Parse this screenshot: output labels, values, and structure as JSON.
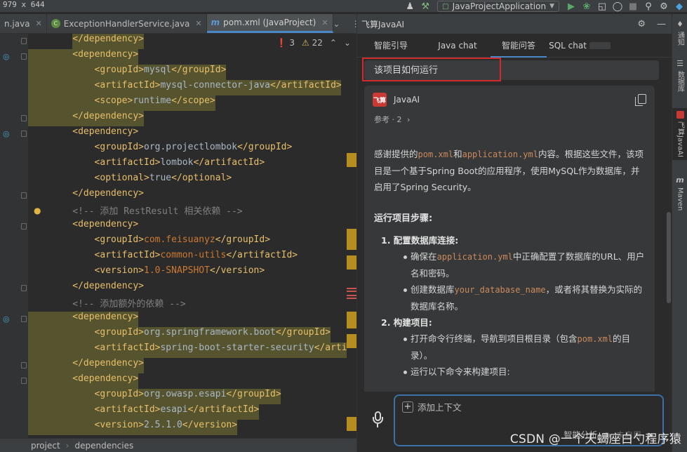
{
  "screen_dims_label": "979 x 644",
  "toolbar": {
    "run_config": "JavaProjectApplication",
    "icons": [
      "user-icon",
      "hammer-icon",
      "run-config-icon",
      "run-icon",
      "debug-icon",
      "coverage-icon",
      "profile-icon",
      "stop-icon",
      "search-icon",
      "settings-icon",
      "jetbrains-logo-icon"
    ]
  },
  "editor_tabs": [
    {
      "label": "n.java",
      "icon": "java-file-icon",
      "active": false
    },
    {
      "label": "ExceptionHandlerService.java",
      "icon": "java-class-icon",
      "active": false
    },
    {
      "label": "pom.xml (JavaProject)",
      "icon": "maven-icon",
      "active": true
    }
  ],
  "inspection": {
    "errors": "3",
    "warnings": "22"
  },
  "code_lines": [
    {
      "indent": 4,
      "parts": [
        [
          "tag",
          "</dependency>"
        ]
      ],
      "hl": [
        [
          "tag",
          0,
          0
        ]
      ],
      "hl_line": false
    },
    {
      "indent": 4,
      "parts": [
        [
          "tag",
          "<dependency>"
        ]
      ],
      "hl_line": true
    },
    {
      "indent": 8,
      "parts": [
        [
          "tag",
          "<groupId>"
        ],
        [
          "val",
          "mysql"
        ],
        [
          "tag",
          "</groupId>"
        ]
      ],
      "hl_line": true
    },
    {
      "indent": 8,
      "parts": [
        [
          "tag",
          "<artifactId>"
        ],
        [
          "val",
          "mysql-connector-java"
        ],
        [
          "tag",
          "</artifactId>"
        ]
      ],
      "hl_line": true
    },
    {
      "indent": 8,
      "parts": [
        [
          "tag",
          "<scope>"
        ],
        [
          "val",
          "runtime"
        ],
        [
          "tag",
          "</scope>"
        ]
      ],
      "hl_line": true
    },
    {
      "indent": 4,
      "parts": [
        [
          "tag",
          "</dependency>"
        ]
      ],
      "hl_line": true
    },
    {
      "indent": 4,
      "parts": [
        [
          "tag",
          "<dependency>"
        ]
      ],
      "hl_line": false
    },
    {
      "indent": 8,
      "parts": [
        [
          "tag",
          "<groupId>"
        ],
        [
          "val",
          "org.projectlombok"
        ],
        [
          "tag",
          "</groupId>"
        ]
      ],
      "hl_line": false
    },
    {
      "indent": 8,
      "parts": [
        [
          "tag",
          "<artifactId>"
        ],
        [
          "val",
          "lombok"
        ],
        [
          "tag",
          "</artifactId>"
        ]
      ],
      "hl_line": false
    },
    {
      "indent": 8,
      "parts": [
        [
          "tag",
          "<optional>"
        ],
        [
          "val",
          "true"
        ],
        [
          "tag",
          "</optional>"
        ]
      ],
      "hl_line": false
    },
    {
      "indent": 4,
      "parts": [
        [
          "tag",
          "</dependency>"
        ]
      ],
      "hl_line": false
    },
    {
      "indent": 4,
      "parts": [
        [
          "cmt",
          "<!-- 添加 RestResult 相关依赖 -->"
        ]
      ],
      "hl_line": false
    },
    {
      "indent": 4,
      "parts": [
        [
          "tag",
          "<dependency>"
        ]
      ],
      "hl_line": false
    },
    {
      "indent": 8,
      "parts": [
        [
          "tag",
          "<groupId>"
        ],
        [
          "dep",
          "com.feisuanyz"
        ],
        [
          "tag",
          "</groupId>"
        ]
      ],
      "hl_line": false
    },
    {
      "indent": 8,
      "parts": [
        [
          "tag",
          "<artifactId>"
        ],
        [
          "dep",
          "common-utils"
        ],
        [
          "tag",
          "</artifactId>"
        ]
      ],
      "hl_line": false
    },
    {
      "indent": 8,
      "parts": [
        [
          "tag",
          "<version>"
        ],
        [
          "dep",
          "1.0-SNAPSHOT"
        ],
        [
          "tag",
          "</version>"
        ]
      ],
      "hl_line": false
    },
    {
      "indent": 4,
      "parts": [
        [
          "tag",
          "</dependency>"
        ]
      ],
      "hl_line": false
    },
    {
      "indent": 4,
      "parts": [
        [
          "cmt",
          "<!-- 添加额外的依赖 -->"
        ]
      ],
      "hl_line": false
    },
    {
      "indent": 4,
      "parts": [
        [
          "tag",
          "<dependency>"
        ]
      ],
      "hl_line": true
    },
    {
      "indent": 8,
      "parts": [
        [
          "tag",
          "<groupId>"
        ],
        [
          "val",
          "org.springframework.boot"
        ],
        [
          "tag",
          "</groupId>"
        ]
      ],
      "hl_line": true
    },
    {
      "indent": 8,
      "parts": [
        [
          "tag",
          "<artifactId>"
        ],
        [
          "val",
          "spring-boot-starter-security"
        ],
        [
          "tag",
          "</arti"
        ]
      ],
      "hl_line": true
    },
    {
      "indent": 4,
      "parts": [
        [
          "tag",
          "</dependency>"
        ]
      ],
      "hl_line": true
    },
    {
      "indent": 4,
      "parts": [
        [
          "tag",
          "<dependency>"
        ]
      ],
      "hl_line": true
    },
    {
      "indent": 8,
      "parts": [
        [
          "tag",
          "<groupId>"
        ],
        [
          "val",
          "org.owasp.esapi"
        ],
        [
          "tag",
          "</groupId>"
        ]
      ],
      "hl_line": true
    },
    {
      "indent": 8,
      "parts": [
        [
          "tag",
          "<artifactId>"
        ],
        [
          "val",
          "esapi"
        ],
        [
          "tag",
          "</artifactId>"
        ]
      ],
      "hl_line": true
    },
    {
      "indent": 8,
      "parts": [
        [
          "tag",
          "<version>"
        ],
        [
          "val",
          "2.5.1.0"
        ],
        [
          "tag",
          "</version>"
        ]
      ],
      "hl_line": true
    }
  ],
  "breadcrumb": [
    "project",
    "dependencies"
  ],
  "panel": {
    "title": "飞算JavaAI",
    "tabs": [
      "智能引导",
      "Java chat",
      "智能问答",
      "SQL chat"
    ],
    "active_tab": "智能问答",
    "question": "该项目如何运行",
    "assistant_name": "JavaAI",
    "assistant_logo_text": "飞算",
    "refs_label": "参考 · 2",
    "answer": {
      "intro_pre": "感谢提供的",
      "intro_code1": "pom.xml",
      "intro_mid1": "和",
      "intro_code2": "application.yml",
      "intro_post": "内容。根据这些文件，该项目是一个基于Spring Boot的应用程序，使用MySQL作为数据库，并启用了Spring Security。",
      "steps_heading": "运行项目步骤:",
      "step1_title": "1. 配置数据库连接:",
      "step1_b1_pre": "确保在",
      "step1_b1_code": "application.yml",
      "step1_b1_post": "中正确配置了数据库的URL、用户名和密码。",
      "step1_b2_pre": "创建数据库",
      "step1_b2_code": "your_database_name",
      "step1_b2_post": "，或者将其替换为实际的数据库名称。",
      "step2_title": "2. 构建项目:",
      "step2_b1_pre": "打开命令行终端，导航到项目根目录（包含",
      "step2_b1_code": "pom.xml",
      "step2_b1_post": "的目录）。",
      "step2_b2": "运行以下命令来构建项目:"
    },
    "composer": {
      "add_context": "添加上下文",
      "analysis_label": "智能分析",
      "unused_label": "未启用"
    }
  },
  "strip": [
    {
      "label": "通知",
      "icon": "bell-icon"
    },
    {
      "label": "数据库",
      "icon": "database-icon"
    },
    {
      "label": "飞算JavaAI",
      "icon": "javaai-icon"
    },
    {
      "label": "Maven",
      "icon": "maven-icon"
    }
  ],
  "watermark": "CSDN @一个天蝎座白勺程序猿"
}
